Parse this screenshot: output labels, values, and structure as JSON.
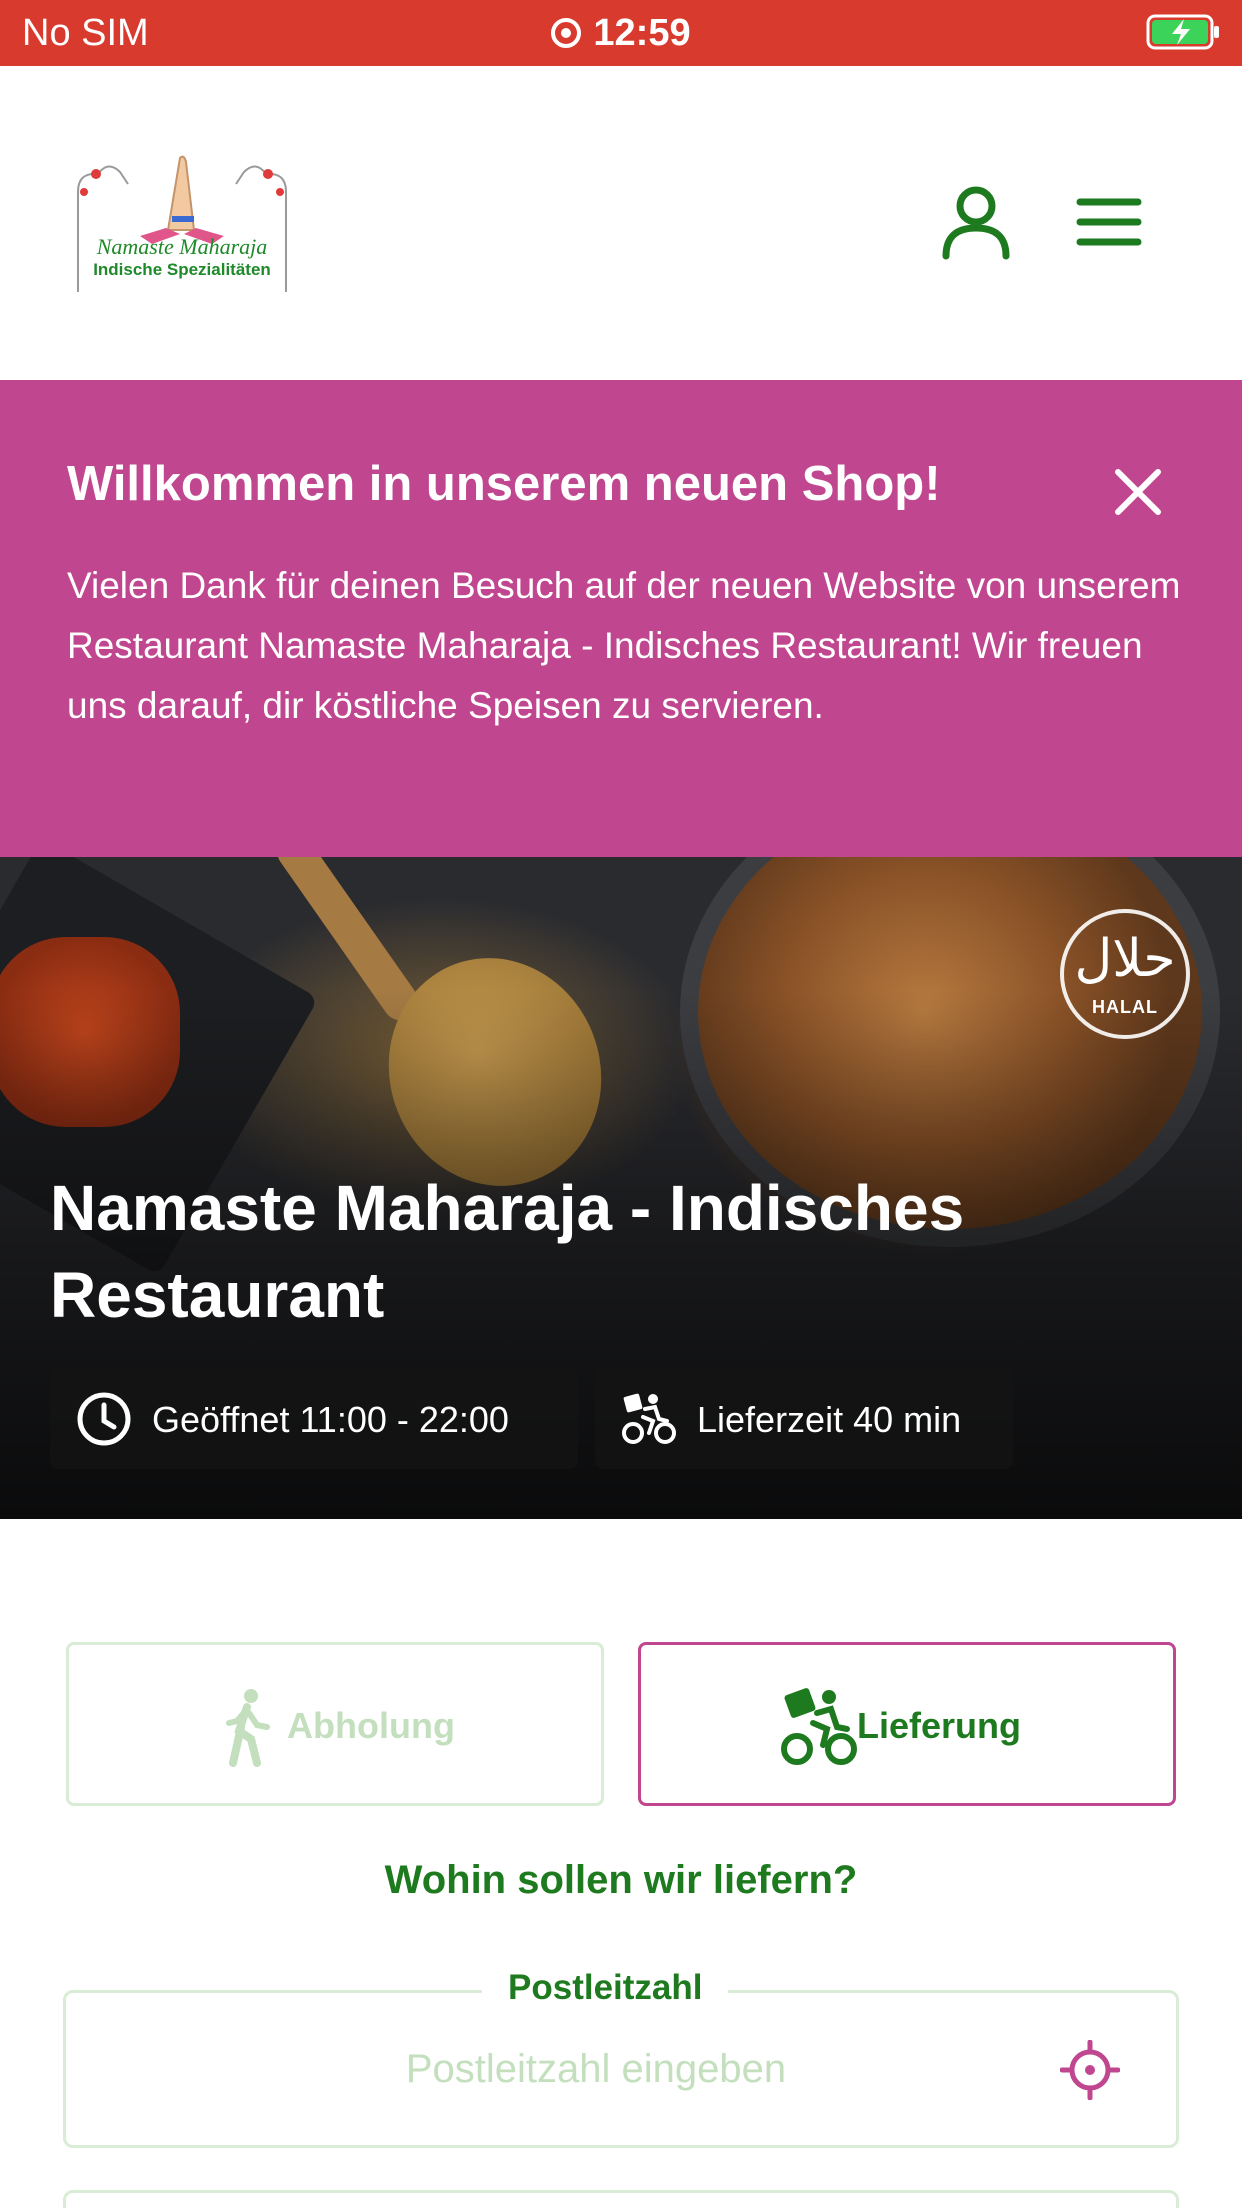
{
  "status_bar": {
    "carrier": "No SIM",
    "time": "12:59"
  },
  "header": {
    "logo_name": "Namaste Maharaja",
    "logo_subtitle": "Indische Spezialitäten",
    "user_icon": "user-icon",
    "menu_icon": "hamburger-menu-icon"
  },
  "banner": {
    "title": "Willkommen in unserem neuen Shop!",
    "text": "Vielen Dank für deinen Besuch auf der neuen Website von unserem Restaurant Namaste Maharaja - Indisches Restaurant! Wir freuen uns darauf, dir köstliche Speisen zu servieren.",
    "background": "#c0468f"
  },
  "hero": {
    "title": "Namaste Maharaja - Indisches Restaurant",
    "halal_label": "HALAL",
    "halal_arabic": "حلال",
    "opening": "Geöffnet 11:00 - 22:00",
    "delivery_time": "Lieferzeit 40 min"
  },
  "order_mode": {
    "pickup_label": "Abholung",
    "delivery_label": "Lieferung",
    "selected": "Lieferung"
  },
  "delivery_form": {
    "question": "Wohin sollen wir liefern?",
    "postal_label": "Postleitzahl",
    "postal_placeholder": "Postleitzahl eingeben",
    "postal_value": ""
  },
  "colors": {
    "status_bar": "#d93a2e",
    "accent_pink": "#c0468f",
    "brand_green": "#1e7a1e",
    "muted_green": "#c3dfbd"
  }
}
